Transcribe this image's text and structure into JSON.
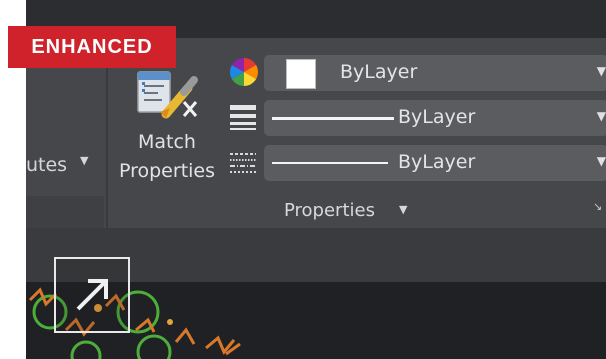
{
  "badge": {
    "text": "ENHANCED",
    "color": "#d0222b"
  },
  "left_panel": {
    "label": "utes",
    "dropdown_icon": "caret-down-icon"
  },
  "match_properties": {
    "label": "Match\nProperties",
    "icon": "match-properties-brush-icon"
  },
  "properties_rows": [
    {
      "icon": "color-wheel-icon",
      "value": "ByLayer",
      "swatch_color": "#ffffff"
    },
    {
      "icon": "lineweight-icon",
      "value": "ByLayer"
    },
    {
      "icon": "linetype-icon",
      "value": "ByLayer"
    }
  ],
  "panel": {
    "title": "Properties",
    "title_icon": "caret-down-icon",
    "launcher_icon": "dialog-launcher-icon"
  },
  "expand_button": {
    "icon": "expand-arrow-icon"
  },
  "colors": {
    "ribbon_bg": "#46474b",
    "dropdown_bg": "#5b5c60",
    "canvas_bg": "#1f2125",
    "accent_green": "#4caf3a",
    "accent_orange": "#d9782a"
  }
}
